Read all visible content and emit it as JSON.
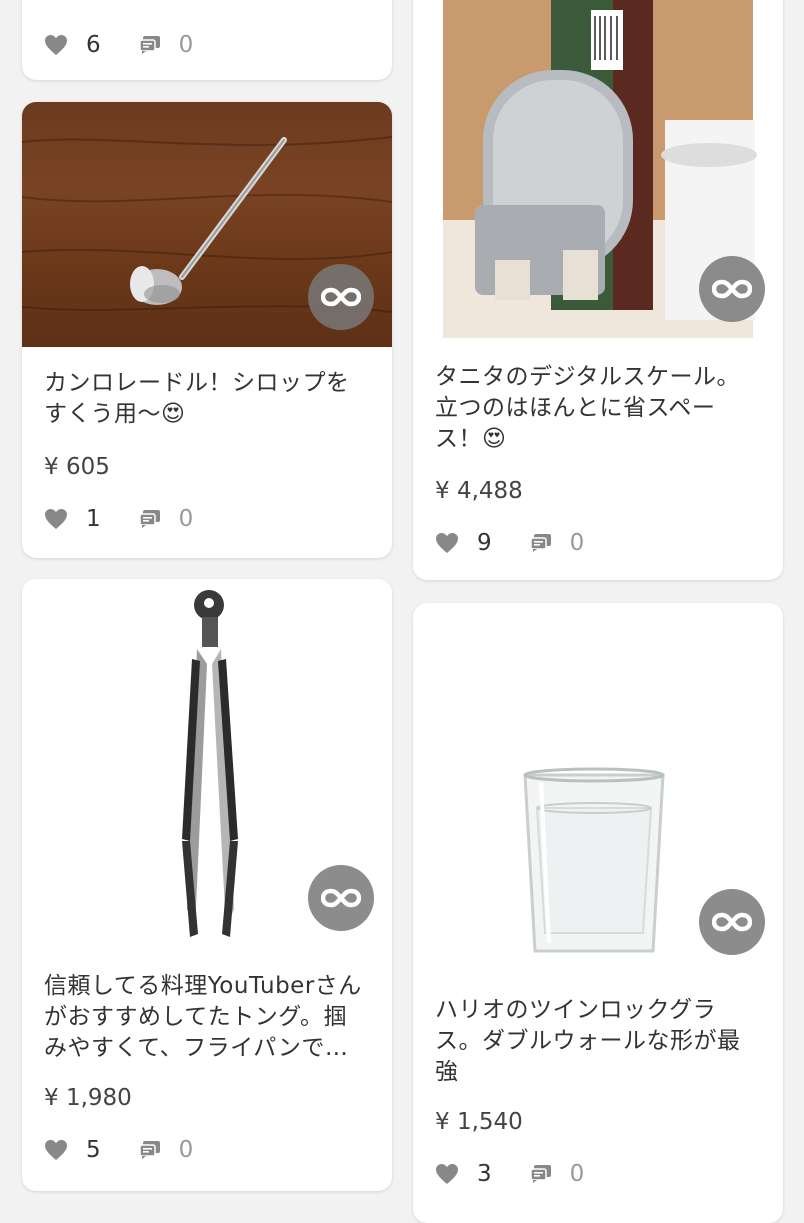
{
  "cards": [
    {
      "likes": "6",
      "comments": "0"
    },
    {
      "title": "カンロレードル！シロップをすくう用〜😍",
      "price": "¥ 605",
      "likes": "1",
      "comments": "0"
    },
    {
      "title": "タニタのデジタルスケール。立つのはほんとに省スペース！😍",
      "price": "¥ 4,488",
      "likes": "9",
      "comments": "0"
    },
    {
      "title": "信頼してる料理YouTuberさんがおすすめしてたトング。掴みやすくて、フライパンでも使いやすい",
      "price": "¥ 1,980",
      "likes": "5",
      "comments": "0"
    },
    {
      "title": "ハリオのツインロックグラス。ダブルウォールな形が最強",
      "price": "¥ 1,540",
      "likes": "3",
      "comments": "0"
    }
  ],
  "icons": {
    "like": "heart-icon",
    "comment": "comment-icon",
    "badge": "infinity-icon"
  }
}
